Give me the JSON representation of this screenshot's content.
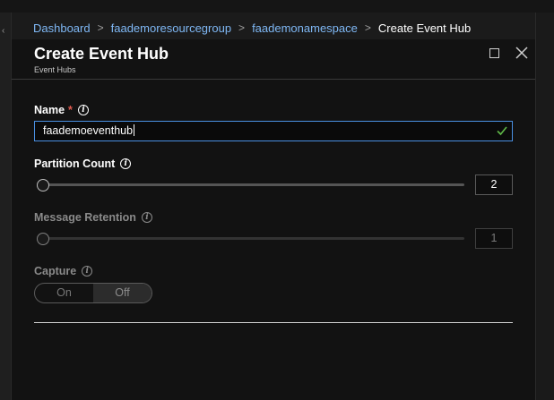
{
  "breadcrumb": {
    "items": [
      "Dashboard",
      "faademoresourcegroup",
      "faademonamespace"
    ],
    "current": "Create Event Hub",
    "separator": ">"
  },
  "blade": {
    "title": "Create Event Hub",
    "subtitle": "Event Hubs"
  },
  "form": {
    "name": {
      "label": "Name",
      "required_mark": "*",
      "value": "faademoeventhub",
      "valid": true
    },
    "partition_count": {
      "label": "Partition Count",
      "value": "2",
      "level": 0.0
    },
    "message_retention": {
      "label": "Message Retention",
      "value": "1",
      "level": 0.0,
      "disabled": true
    },
    "capture": {
      "label": "Capture",
      "options": [
        "On",
        "Off"
      ],
      "selected": "Off",
      "disabled": true
    }
  },
  "icons": {
    "info": "info-icon",
    "check": "check-icon",
    "maximize": "maximize-icon",
    "close": "close-icon"
  },
  "colors": {
    "accent": "#4a90e2",
    "link": "#7fb8f5",
    "required": "#e05a4f",
    "valid": "#5fb848"
  }
}
